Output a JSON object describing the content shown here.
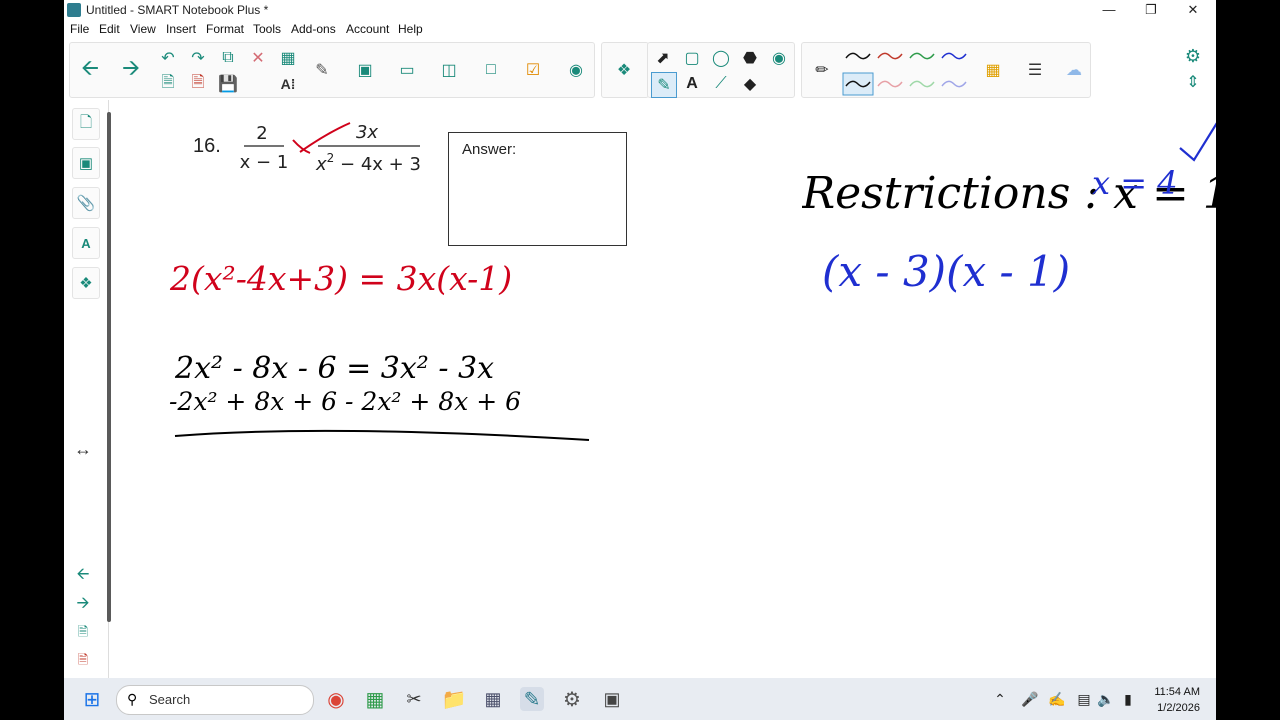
{
  "window": {
    "title": "Untitled - SMART Notebook Plus *"
  },
  "menu": [
    "File",
    "Edit",
    "View",
    "Insert",
    "Format",
    "Tools",
    "Add-ons",
    "Account",
    "Help"
  ],
  "colors": {
    "accent": "#2e7d8f",
    "red_ink": "#d0021b",
    "blue_ink": "#1f2fd0",
    "black_ink": "#000000",
    "toolbar_green": "#1a8a7a"
  },
  "problem": {
    "number": "16.",
    "left_numerator": "2",
    "left_denominator": "x − 1",
    "right_numerator": "3x",
    "right_denominator_base": "x",
    "right_denominator_exp": "2",
    "right_denominator_rest": " − 4x + 3",
    "answer_label": "Answer:"
  },
  "handwriting": {
    "red_equation": "2(x²-4x+3) = 3x(x-1)",
    "black_line1": "2x² - 8x - 6  = 3x² - 3x",
    "black_line2": "-2x² + 8x + 6   - 2x² + 8x + 6",
    "restrictions": "Restrictions : x = 1",
    "restriction2": "x = 4",
    "factored": "(x - 3)(x - 1)"
  },
  "taskbar": {
    "search_placeholder": "Search",
    "time": "11:54 AM",
    "date": "1/2/2026"
  }
}
